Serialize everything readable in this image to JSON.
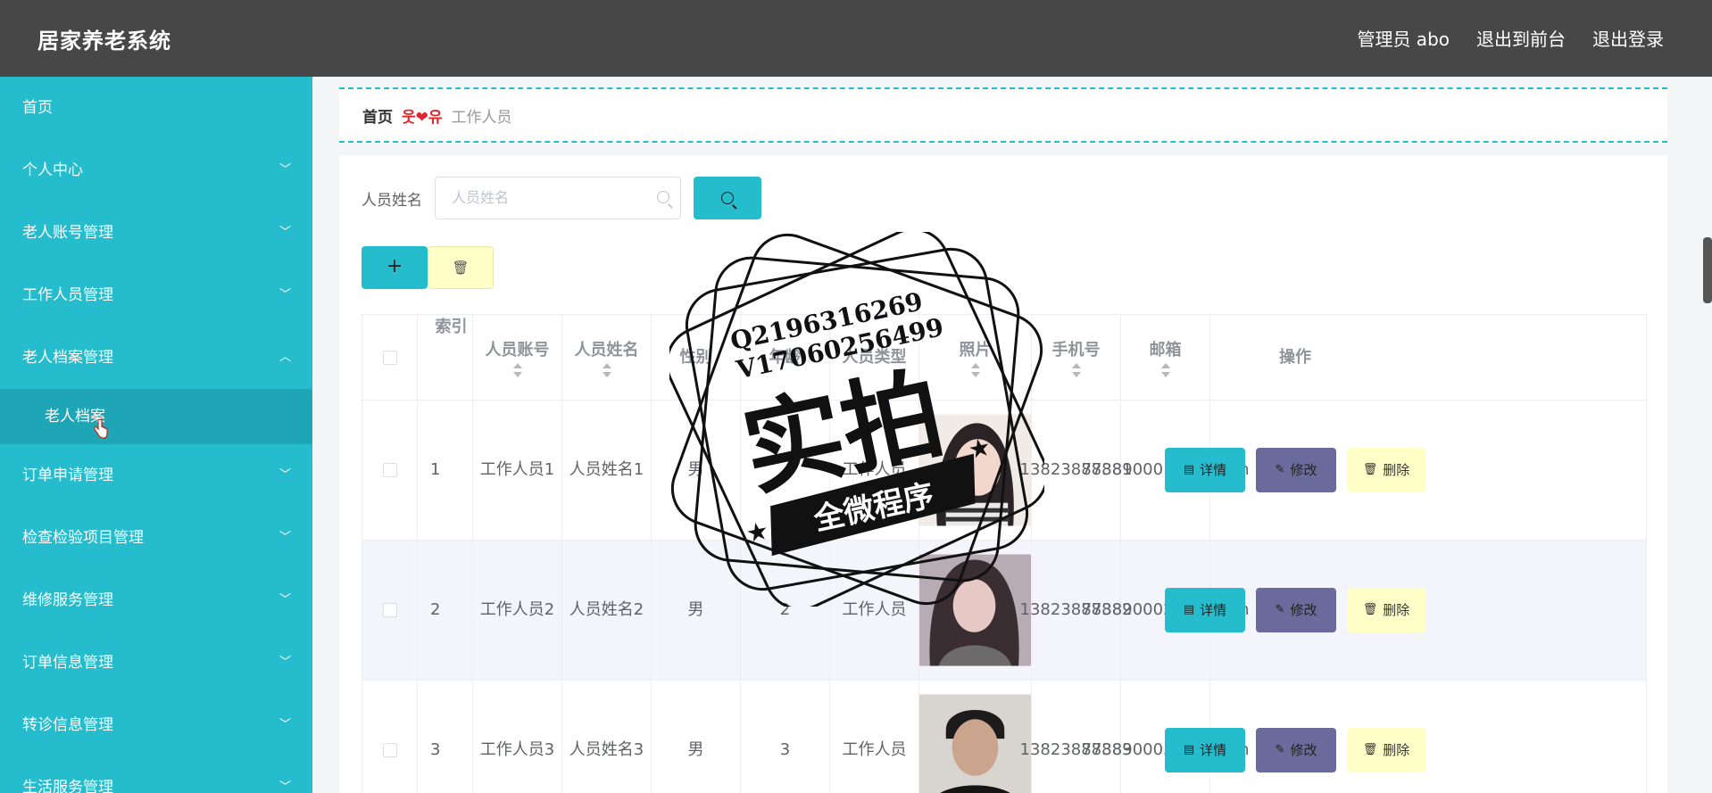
{
  "header": {
    "title": "居家养老系统",
    "user": "管理员 abo",
    "frontend": "退出到前台",
    "logout": "退出登录"
  },
  "sidebar": {
    "items": [
      {
        "label": "首页"
      },
      {
        "label": "个人中心"
      },
      {
        "label": "老人账号管理"
      },
      {
        "label": "工作人员管理"
      },
      {
        "label": "老人档案管理"
      },
      {
        "label": "订单申请管理"
      },
      {
        "label": "检查检验项目管理"
      },
      {
        "label": "维修服务管理"
      },
      {
        "label": "订单信息管理"
      },
      {
        "label": "转诊信息管理"
      },
      {
        "label": "生活服务管理"
      }
    ],
    "sub_active": "老人档案"
  },
  "breadcrumb": {
    "home": "首页",
    "sep": "웃❤유",
    "current": "工作人员"
  },
  "search": {
    "label": "人员姓名",
    "placeholder": "人员姓名"
  },
  "table": {
    "headers": [
      "索引",
      "人员账号",
      "人员姓名",
      "性别",
      "年龄",
      "人员类型",
      "照片",
      "手机号",
      "邮箱",
      "操作"
    ],
    "rows": [
      {
        "index": "1",
        "account": "工作人员1",
        "name": "人员姓名1",
        "gender": "男",
        "age": "",
        "type": "工作人员",
        "phone": "13823888881",
        "email": "773890001@qq.com"
      },
      {
        "index": "2",
        "account": "工作人员2",
        "name": "人员姓名2",
        "gender": "男",
        "age": "2",
        "type": "工作人员",
        "phone": "13823888882",
        "email": "773890002@qq.com"
      },
      {
        "index": "3",
        "account": "工作人员3",
        "name": "人员姓名3",
        "gender": "男",
        "age": "3",
        "type": "工作人员",
        "phone": "13823888883",
        "email": "773890003@qq.com"
      }
    ],
    "ops": {
      "detail": "详情",
      "edit": "修改",
      "delete": "删除"
    }
  },
  "watermark": {
    "line1": "Q2196316269",
    "line2": "V17060256499",
    "big": "实拍",
    "banner": "全微程序"
  },
  "colors": {
    "topbar": "#474747",
    "sidebar": "#25bccd",
    "accent": "#25bccd",
    "edit": "#6b6a9c",
    "delete": "#ffffc8"
  }
}
